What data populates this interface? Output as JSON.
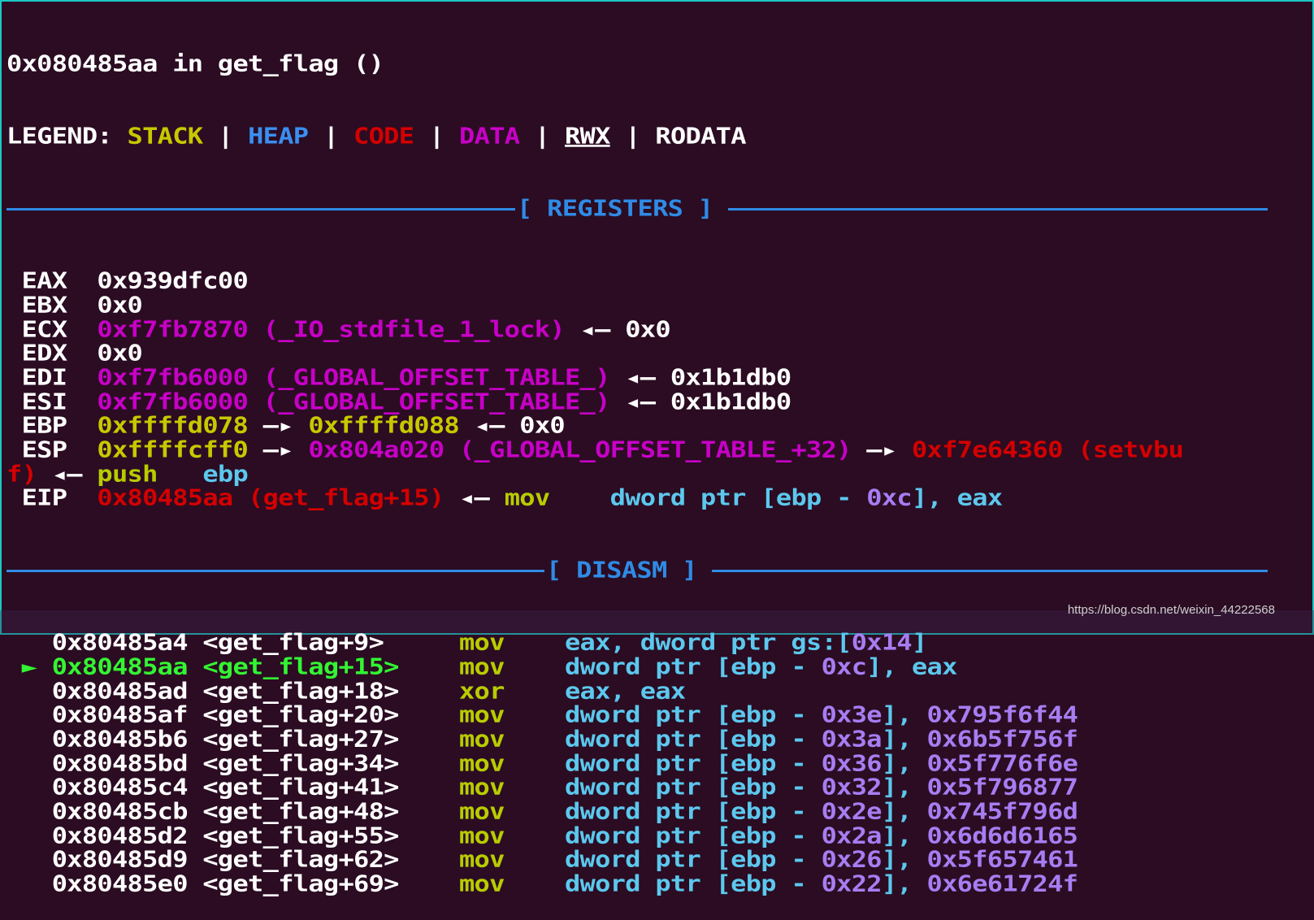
{
  "colors": {
    "background": "#2b0c22",
    "border": "#19c9c3",
    "stack": "#c8c800",
    "heap": "#3a8ef0",
    "code": "#d40000",
    "data": "#c800c8",
    "separator": "#2f8be6",
    "current": "#33f533"
  },
  "header": {
    "title": "0x080485aa in get_flag ()"
  },
  "legend": [
    {
      "t": "LEGEND: ",
      "c": "w"
    },
    {
      "t": "STACK",
      "c": "y"
    },
    {
      "t": " | ",
      "c": "w"
    },
    {
      "t": "HEAP",
      "c": "b"
    },
    {
      "t": " | ",
      "c": "w"
    },
    {
      "t": "CODE",
      "c": "r"
    },
    {
      "t": " | ",
      "c": "w"
    },
    {
      "t": "DATA",
      "c": "m"
    },
    {
      "t": " | ",
      "c": "w"
    },
    {
      "t": "RWX",
      "c": "w u"
    },
    {
      "t": " | ",
      "c": "w"
    },
    {
      "t": "RODATA",
      "c": "w"
    }
  ],
  "registers_label": "[ REGISTERS ]",
  "registers": [
    [
      {
        "t": " EAX  ",
        "c": "w"
      },
      {
        "t": "0x939dfc00",
        "c": "w"
      }
    ],
    [
      {
        "t": " EBX  ",
        "c": "w"
      },
      {
        "t": "0x0",
        "c": "w"
      }
    ],
    [
      {
        "t": " ECX  ",
        "c": "w"
      },
      {
        "t": "0xf7fb7870 (_IO_stdfile_1_lock)",
        "c": "m"
      },
      {
        "t": " ◂— 0x0",
        "c": "w"
      }
    ],
    [
      {
        "t": " EDX  ",
        "c": "w"
      },
      {
        "t": "0x0",
        "c": "w"
      }
    ],
    [
      {
        "t": " EDI  ",
        "c": "w"
      },
      {
        "t": "0xf7fb6000 (_GLOBAL_OFFSET_TABLE_)",
        "c": "m"
      },
      {
        "t": " ◂— 0x1b1db0",
        "c": "w"
      }
    ],
    [
      {
        "t": " ESI  ",
        "c": "w"
      },
      {
        "t": "0xf7fb6000 (_GLOBAL_OFFSET_TABLE_)",
        "c": "m"
      },
      {
        "t": " ◂— 0x1b1db0",
        "c": "w"
      }
    ],
    [
      {
        "t": " EBP  ",
        "c": "w"
      },
      {
        "t": "0xffffd078",
        "c": "y"
      },
      {
        "t": " —▸ ",
        "c": "w"
      },
      {
        "t": "0xffffd088",
        "c": "y"
      },
      {
        "t": " ◂— 0x0",
        "c": "w"
      }
    ],
    [
      {
        "t": " ESP  ",
        "c": "w"
      },
      {
        "t": "0xffffcff0",
        "c": "y"
      },
      {
        "t": " —▸ ",
        "c": "w"
      },
      {
        "t": "0x804a020 (_GLOBAL_OFFSET_TABLE_+32)",
        "c": "m"
      },
      {
        "t": " —▸ ",
        "c": "w"
      },
      {
        "t": "0xf7e64360 (setvbu",
        "c": "r"
      }
    ],
    [
      {
        "t": "f)",
        "c": "r"
      },
      {
        "t": " ◂— ",
        "c": "w"
      },
      {
        "t": "push",
        "c": "g"
      },
      {
        "t": "   ",
        "c": "w"
      },
      {
        "t": "ebp",
        "c": "c"
      }
    ],
    [
      {
        "t": " EIP  ",
        "c": "w"
      },
      {
        "t": "0x80485aa (get_flag+15)",
        "c": "r"
      },
      {
        "t": " ◂— ",
        "c": "w"
      },
      {
        "t": "mov",
        "c": "g"
      },
      {
        "t": "    dword ptr [ebp - ",
        "c": "c"
      },
      {
        "t": "0xc",
        "c": "p"
      },
      {
        "t": "], eax",
        "c": "c"
      }
    ]
  ],
  "disasm_label": "[ DISASM ]",
  "disasm": [
    {
      "marker": "   ",
      "addr": "0x80485a4 <get_flag+9>     ",
      "op": "mov",
      "args": [
        {
          "t": "    eax, dword ptr gs:[",
          "c": "c"
        },
        {
          "t": "0x14",
          "c": "p"
        },
        {
          "t": "]",
          "c": "c"
        }
      ],
      "current": false
    },
    {
      "marker": " ► ",
      "addr": "0x80485aa <get_flag+15>    ",
      "op": "mov",
      "args": [
        {
          "t": "    dword ptr [ebp - ",
          "c": "c"
        },
        {
          "t": "0xc",
          "c": "p"
        },
        {
          "t": "], eax",
          "c": "c"
        }
      ],
      "current": true
    },
    {
      "marker": "   ",
      "addr": "0x80485ad <get_flag+18>    ",
      "op": "xor",
      "args": [
        {
          "t": "    eax, eax",
          "c": "c"
        }
      ],
      "current": false
    },
    {
      "marker": "   ",
      "addr": "0x80485af <get_flag+20>    ",
      "op": "mov",
      "args": [
        {
          "t": "    dword ptr [ebp - ",
          "c": "c"
        },
        {
          "t": "0x3e",
          "c": "p"
        },
        {
          "t": "], ",
          "c": "c"
        },
        {
          "t": "0x795f6f44",
          "c": "p"
        }
      ],
      "current": false
    },
    {
      "marker": "   ",
      "addr": "0x80485b6 <get_flag+27>    ",
      "op": "mov",
      "args": [
        {
          "t": "    dword ptr [ebp - ",
          "c": "c"
        },
        {
          "t": "0x3a",
          "c": "p"
        },
        {
          "t": "], ",
          "c": "c"
        },
        {
          "t": "0x6b5f756f",
          "c": "p"
        }
      ],
      "current": false
    },
    {
      "marker": "   ",
      "addr": "0x80485bd <get_flag+34>    ",
      "op": "mov",
      "args": [
        {
          "t": "    dword ptr [ebp - ",
          "c": "c"
        },
        {
          "t": "0x36",
          "c": "p"
        },
        {
          "t": "], ",
          "c": "c"
        },
        {
          "t": "0x5f776f6e",
          "c": "p"
        }
      ],
      "current": false
    },
    {
      "marker": "   ",
      "addr": "0x80485c4 <get_flag+41>    ",
      "op": "mov",
      "args": [
        {
          "t": "    dword ptr [ebp - ",
          "c": "c"
        },
        {
          "t": "0x32",
          "c": "p"
        },
        {
          "t": "], ",
          "c": "c"
        },
        {
          "t": "0x5f796877",
          "c": "p"
        }
      ],
      "current": false
    },
    {
      "marker": "   ",
      "addr": "0x80485cb <get_flag+48>    ",
      "op": "mov",
      "args": [
        {
          "t": "    dword ptr [ebp - ",
          "c": "c"
        },
        {
          "t": "0x2e",
          "c": "p"
        },
        {
          "t": "], ",
          "c": "c"
        },
        {
          "t": "0x745f796d",
          "c": "p"
        }
      ],
      "current": false
    },
    {
      "marker": "   ",
      "addr": "0x80485d2 <get_flag+55>    ",
      "op": "mov",
      "args": [
        {
          "t": "    dword ptr [ebp - ",
          "c": "c"
        },
        {
          "t": "0x2a",
          "c": "p"
        },
        {
          "t": "], ",
          "c": "c"
        },
        {
          "t": "0x6d6d6165",
          "c": "p"
        }
      ],
      "current": false
    },
    {
      "marker": "   ",
      "addr": "0x80485d9 <get_flag+62>    ",
      "op": "mov",
      "args": [
        {
          "t": "    dword ptr [ebp - ",
          "c": "c"
        },
        {
          "t": "0x26",
          "c": "p"
        },
        {
          "t": "], ",
          "c": "c"
        },
        {
          "t": "0x5f657461",
          "c": "p"
        }
      ],
      "current": false
    },
    {
      "marker": "   ",
      "addr": "0x80485e0 <get_flag+69>    ",
      "op": "mov",
      "args": [
        {
          "t": "    dword ptr [ebp - ",
          "c": "c"
        },
        {
          "t": "0x22",
          "c": "p"
        },
        {
          "t": "], ",
          "c": "c"
        },
        {
          "t": "0x6e61724f",
          "c": "p"
        }
      ],
      "current": false
    }
  ],
  "watermark": "https://blog.csdn.net/weixin_44222568"
}
